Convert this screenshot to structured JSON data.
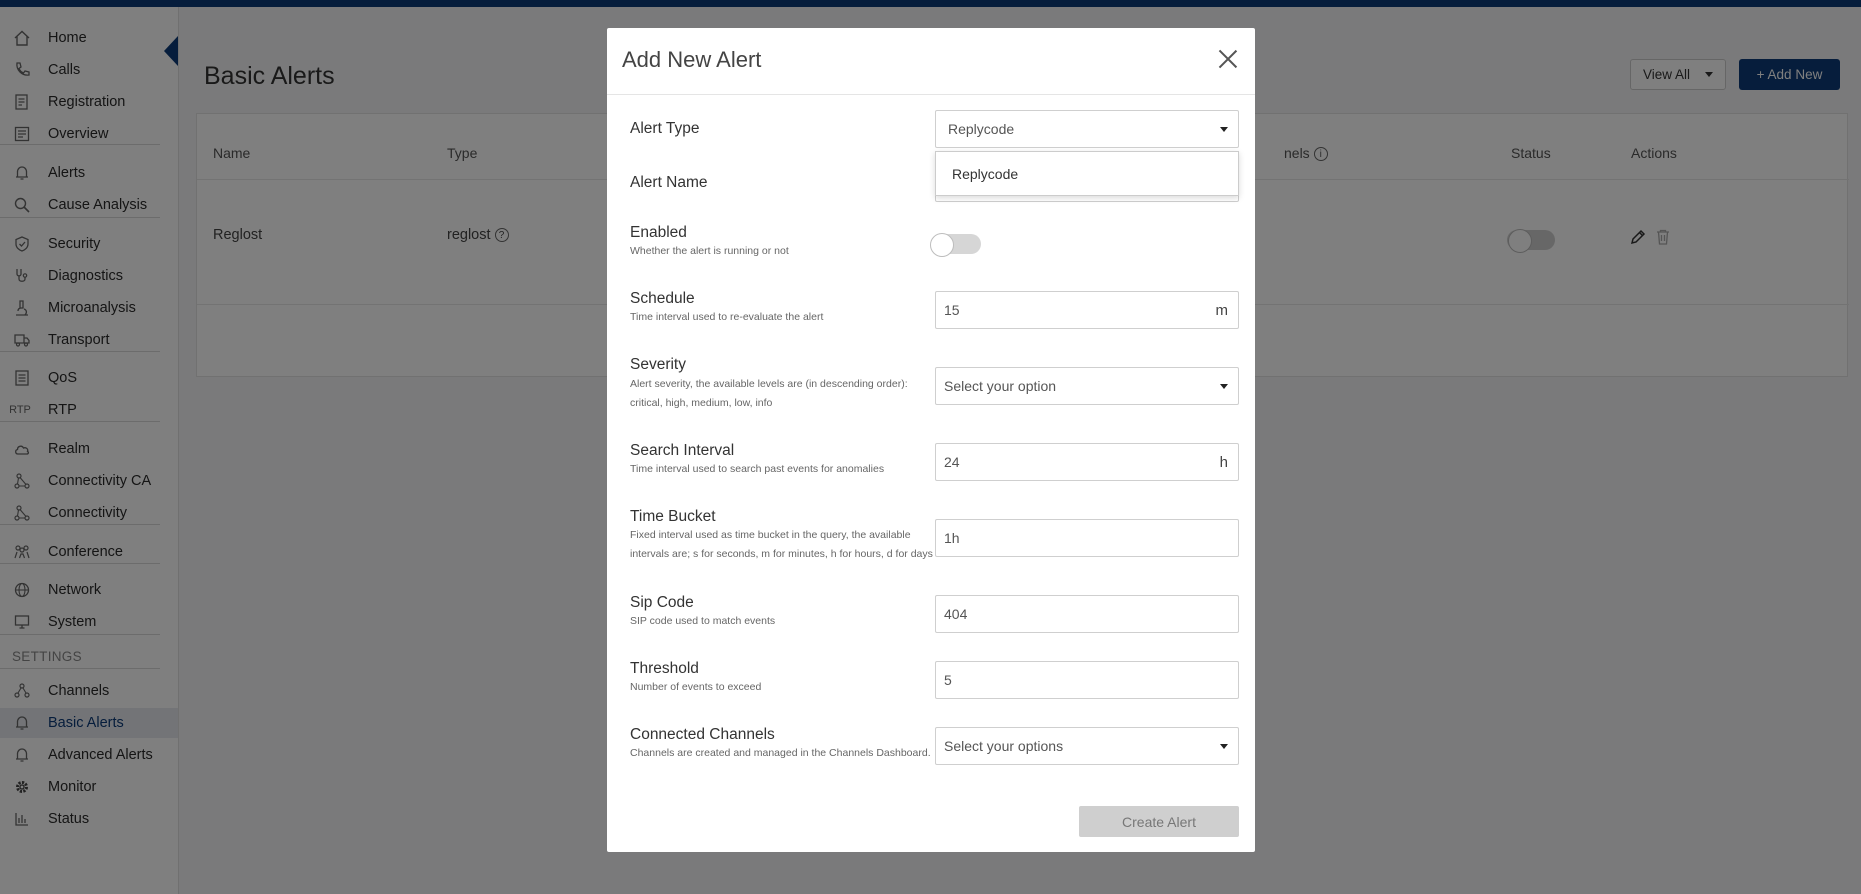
{
  "sidebar": {
    "items": [
      {
        "label": "Home",
        "icon": "home-icon"
      },
      {
        "label": "Calls",
        "icon": "phone-icon"
      },
      {
        "label": "Registration",
        "icon": "registration-icon"
      },
      {
        "label": "Overview",
        "icon": "overview-icon"
      },
      {
        "label": "Alerts",
        "icon": "bell-icon"
      },
      {
        "label": "Cause Analysis",
        "icon": "search-icon"
      },
      {
        "label": "Security",
        "icon": "shield-icon"
      },
      {
        "label": "Diagnostics",
        "icon": "stethoscope-icon"
      },
      {
        "label": "Microanalysis",
        "icon": "microscope-icon"
      },
      {
        "label": "Transport",
        "icon": "truck-icon"
      },
      {
        "label": "QoS",
        "icon": "document-icon"
      },
      {
        "label": "RTP",
        "icon": "rtp-icon"
      },
      {
        "label": "Realm",
        "icon": "cloud-icon"
      },
      {
        "label": "Connectivity CA",
        "icon": "network-icon"
      },
      {
        "label": "Connectivity",
        "icon": "network-icon"
      },
      {
        "label": "Conference",
        "icon": "people-icon"
      },
      {
        "label": "Network",
        "icon": "globe-icon"
      },
      {
        "label": "System",
        "icon": "monitor-icon"
      }
    ],
    "settings_label": "SETTINGS",
    "settings_items": [
      {
        "label": "Channels",
        "icon": "channels-icon"
      },
      {
        "label": "Basic Alerts",
        "icon": "bell-icon",
        "active": true
      },
      {
        "label": "Advanced Alerts",
        "icon": "bell-icon"
      },
      {
        "label": "Monitor",
        "icon": "gear-icon"
      },
      {
        "label": "Status",
        "icon": "bar-chart-icon"
      }
    ]
  },
  "page": {
    "title": "Basic Alerts",
    "view_all_label": "View All",
    "add_new_label": "+ Add New"
  },
  "table": {
    "headers": {
      "name": "Name",
      "type": "Type",
      "channels": "nels",
      "status": "Status",
      "actions": "Actions"
    },
    "rows": [
      {
        "name": "Reglost",
        "type": "reglost",
        "status_enabled": false
      }
    ]
  },
  "modal": {
    "title": "Add New Alert",
    "fields": {
      "alert_type": {
        "label": "Alert Type",
        "value": "Replycode",
        "options": [
          "Replycode"
        ]
      },
      "alert_name": {
        "label": "Alert Name"
      },
      "enabled": {
        "label": "Enabled",
        "desc": "Whether the alert is running or not",
        "value": false
      },
      "schedule": {
        "label": "Schedule",
        "desc": "Time interval used to re-evaluate the alert",
        "value": "15",
        "unit": "m"
      },
      "severity": {
        "label": "Severity",
        "desc": "Alert severity, the available levels are (in descending order): critical, high, medium, low, info",
        "placeholder": "Select your option"
      },
      "search_interval": {
        "label": "Search Interval",
        "desc": "Time interval used to search past events for anomalies",
        "value": "24",
        "unit": "h"
      },
      "time_bucket": {
        "label": "Time Bucket",
        "desc": "Fixed interval used as time bucket in the query, the available intervals are; s for seconds, m for minutes, h for hours, d for days",
        "value": "1h"
      },
      "sip_code": {
        "label": "Sip Code",
        "desc": "SIP code used to match events",
        "value": "404"
      },
      "threshold": {
        "label": "Threshold",
        "desc": "Number of events to exceed",
        "value": "5"
      },
      "connected_channels": {
        "label": "Connected Channels",
        "desc": "Channels are created and managed in the Channels Dashboard.",
        "placeholder": "Select your options"
      }
    },
    "create_label": "Create Alert"
  },
  "colors": {
    "brand": "#0c3a78",
    "disabled_button": "#cfcfcf"
  }
}
